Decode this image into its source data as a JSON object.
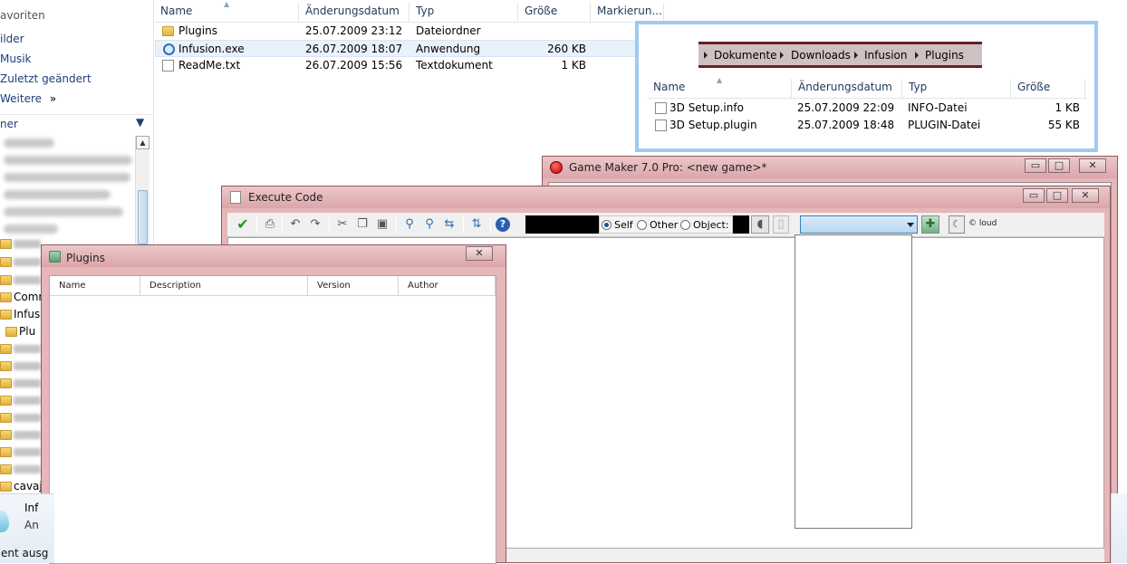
{
  "explorer": {
    "favorites": {
      "header": "avoriten",
      "items": [
        "ilder",
        "Musik",
        "Zuletzt geändert",
        "Weitere"
      ],
      "more_glyph": "»"
    },
    "section_label": "ner",
    "tree": {
      "items": [
        "Plu",
        "Infusi",
        "Comm",
        "cavaj"
      ]
    },
    "columns": [
      "Name",
      "Änderungsdatum",
      "Typ",
      "Größe",
      "Markierun..."
    ],
    "files": [
      {
        "icon": "folder-icon",
        "name": "Plugins",
        "date": "25.07.2009 23:12",
        "type": "Dateiordner",
        "size": ""
      },
      {
        "icon": "exe-icon",
        "name": "Infusion.exe",
        "date": "26.07.2009 18:07",
        "type": "Anwendung",
        "size": "260 KB"
      },
      {
        "icon": "text-file-icon",
        "name": "ReadMe.txt",
        "date": "26.07.2009 15:56",
        "type": "Textdokument",
        "size": "1 KB"
      }
    ],
    "details": {
      "name": "Inf",
      "type": "An"
    },
    "status": "ent ausg"
  },
  "inset": {
    "breadcrumb": [
      "Dokumente",
      "Downloads",
      "Infusion",
      "Plugins"
    ],
    "columns": [
      "Name",
      "Änderungsdatum",
      "Typ",
      "Größe"
    ],
    "files": [
      {
        "name": "3D Setup.info",
        "date": "25.07.2009 22:09",
        "type": "INFO-Datei",
        "size": "1 KB"
      },
      {
        "name": "3D Setup.plugin",
        "date": "25.07.2009 18:48",
        "type": "PLUGIN-Datei",
        "size": "55 KB"
      }
    ]
  },
  "game_maker": {
    "title": "Game Maker 7.0 Pro: <new game>*"
  },
  "execute_code": {
    "title": "Execute Code",
    "radio": {
      "self": "Self",
      "other": "Other",
      "object": "Object:",
      "selected": "self"
    },
    "loud_label": "loud"
  },
  "plugins_window": {
    "title": "Plugins",
    "columns": [
      "Name",
      "Description",
      "Version",
      "Author"
    ]
  },
  "caption": {
    "minimize": "▭",
    "maximize": "□",
    "close": "✕"
  },
  "colors": {
    "window_frame": "#e6b6b9",
    "highlight_border": "#9ec9f3",
    "breadcrumb_bar": "#cfc1c2"
  }
}
